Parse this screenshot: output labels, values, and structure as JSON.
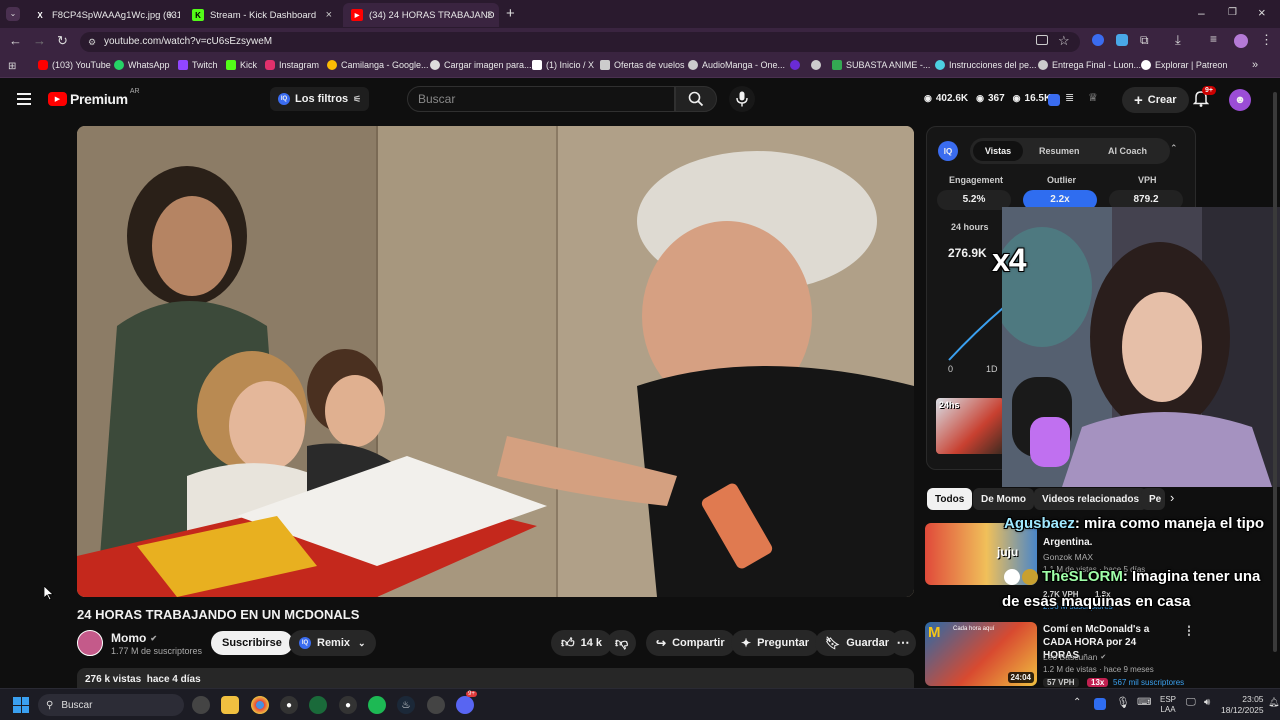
{
  "browser": {
    "tabs": [
      {
        "title": "F8CP4SpWAAAg1Wc.jpg (631×",
        "icon": "x-icon"
      },
      {
        "title": "Stream - Kick Dashboard",
        "icon": "kick-icon"
      },
      {
        "title": "(34) 24 HORAS TRABAJAND",
        "icon": "youtube-icon"
      }
    ],
    "new_tab": "+",
    "url": "youtube.com/watch?v=cU6sEzsyweM",
    "bookmarks": [
      {
        "label": "(103) YouTube",
        "color": "#ff0000"
      },
      {
        "label": "WhatsApp",
        "color": "#25d366"
      },
      {
        "label": "Twitch",
        "color": "#9146ff"
      },
      {
        "label": "Kick",
        "color": "#53fc18"
      },
      {
        "label": "Instagram",
        "color": "#e1306c"
      },
      {
        "label": "Camilanga - Google...",
        "color": "#fbbc04"
      },
      {
        "label": "Cargar imagen para...",
        "color": "#dddddd"
      },
      {
        "label": "(1) Inicio / X",
        "color": "#ffffff"
      },
      {
        "label": "Ofertas de vuelos",
        "color": "#cccccc"
      },
      {
        "label": "AudioManga - One...",
        "color": "#cccccc"
      },
      {
        "label": "",
        "color": "#6a2bd6"
      },
      {
        "label": "",
        "color": "#cccccc"
      },
      {
        "label": "SUBASTA ANIME -...",
        "color": "#34a853"
      },
      {
        "label": "Instrucciones del pe...",
        "color": "#4dd0e1"
      },
      {
        "label": "Entrega Final - Luon...",
        "color": "#cccccc"
      },
      {
        "label": "Explorar | Patreon",
        "color": "#ffffff"
      }
    ]
  },
  "youtube": {
    "logo": "Premium",
    "logo_region": "AR",
    "filters_label": "Los filtros",
    "search_placeholder": "Buscar",
    "stats": {
      "views": "402.6K",
      "likes": "367",
      "comments": "16.5K"
    },
    "create_label": "Crear",
    "notif_badge": "9+"
  },
  "video": {
    "title": "24 HORAS TRABAJANDO EN UN MCDONALS",
    "channel": "Momo",
    "subscribers": "1.77 M de suscriptores",
    "subscribe_label": "Suscribirse",
    "remix_label": "Remix",
    "likes": "14 k",
    "share_label": "Compartir",
    "ask_label": "Preguntar",
    "save_label": "Guardar",
    "meta": "276 k vistas  hace 4 días"
  },
  "iq_panel": {
    "tabs": [
      "Vistas",
      "Resumen",
      "AI Coach"
    ],
    "metric_labels": [
      "Engagement",
      "Outlier",
      "VPH"
    ],
    "metric_values": [
      "5.2%",
      "2.2x",
      "879.2"
    ],
    "range_label": "24 hours",
    "views_count": "276.9K",
    "axis": [
      "0",
      "1D"
    ],
    "thumb_label": "24hs"
  },
  "chips": [
    "Todos",
    "De Momo",
    "Videos relacionados",
    "Pe"
  ],
  "recommendations": [
    {
      "title": "Argentina.",
      "channel": "Gonzok MAX",
      "meta": "1.1 M de vistas · hace 5 días",
      "vph": "2.7K VPH",
      "ratio": "1.8x",
      "subs": "2.96 M suscriptores",
      "thumb_text": "juju"
    },
    {
      "title": "Comí en McDonald's a CADA HORA por 24 HORAS",
      "channel": "Leo Bascuñan",
      "meta": "1.2 M de vistas · hace 9 meses",
      "vph": "57 VPH",
      "ratio": "13x",
      "subs": "567 mil suscriptores",
      "duration": "24:04",
      "thumb_text": "Cada hora aquí"
    }
  ],
  "stream_overlay": {
    "multiplier": "x4",
    "chat": [
      {
        "user": "Agusbaez",
        "text": ": mira como maneja el tipo"
      },
      {
        "user": "TheSLORM",
        "text": ": Imagina tener una"
      },
      {
        "user": "",
        "text": "de esas maquinas en casa"
      }
    ]
  },
  "taskbar": {
    "search_label": "Buscar",
    "lang": "ESP",
    "lang2": "LAA",
    "time": "23:05",
    "date": "18/12/2025",
    "discord_badge": "9+"
  }
}
